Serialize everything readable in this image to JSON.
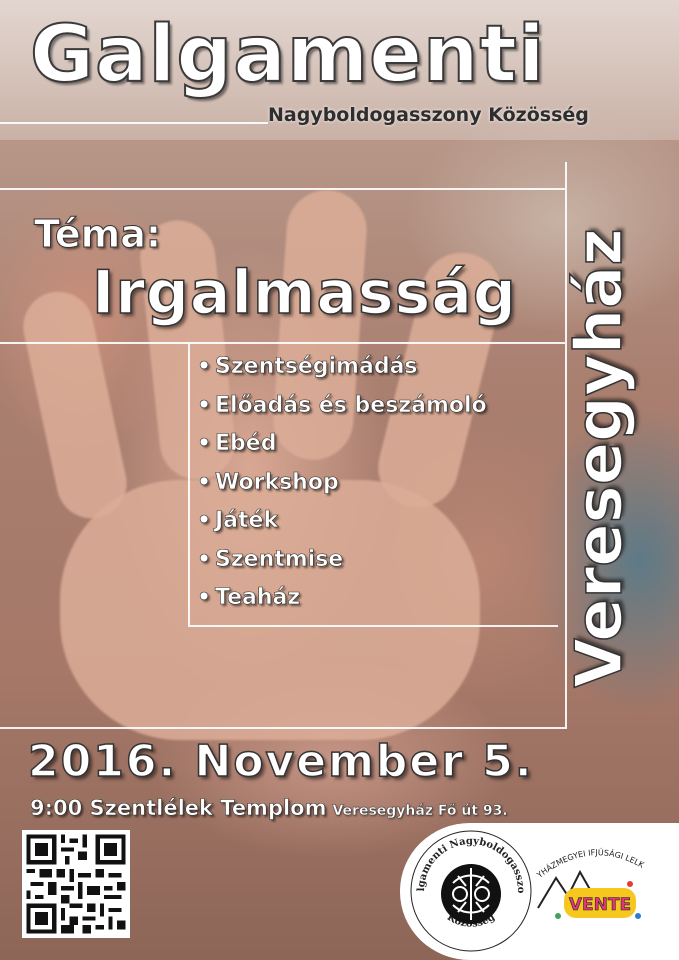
{
  "header": {
    "title": "Galgamenti",
    "subtitle": "Nagyboldogasszony Közösség"
  },
  "theme": {
    "label": "Téma:",
    "value": "Irgalmasság"
  },
  "location_side": "Veresegyház",
  "program": [
    "Szentségimádás",
    "Előadás és beszámoló",
    "Ebéd",
    "Workshop",
    "Játék",
    "Szentmise",
    "Teaház"
  ],
  "program_bullet": "•",
  "event": {
    "date": "2016. November 5.",
    "time_place": "9:00 Szentlélek Templom",
    "address": "Veresegyház Fő út 93."
  },
  "logos": {
    "community_seal_text_top": "Galgamenti Nagyboldogasszony",
    "community_seal_text_bottom": "Közösség",
    "youth_logo_arc": "VÁCI EGYHÁZMEGYEI IFJÚSÁGI LELKÉSZSÉG",
    "youth_logo_word": "VENTE"
  },
  "colors": {
    "text_fill": "#ffffff",
    "text_stroke": "#333333",
    "subtitle": "#2e2e2e"
  }
}
